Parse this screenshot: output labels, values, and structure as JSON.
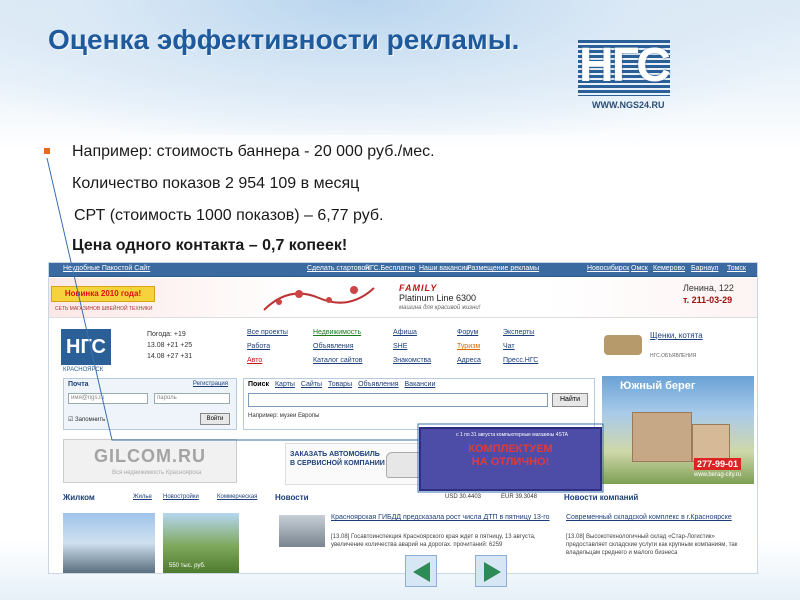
{
  "slide": {
    "title": "Оценка эффективности рекламы.",
    "logo": {
      "letters": "НГС",
      "url": "WWW.NGS24.RU"
    },
    "bullets": [
      "Например: стоимость баннера - 20 000 руб./мес.",
      "Количество показов 2 954 109 в месяц",
      "СРТ (стоимость 1000 показов) – 6,77 руб.",
      "Цена одного контакта – 0,7 копеек!"
    ],
    "accent_color": "#1f5a9c",
    "bullet_color": "#e86a1a"
  },
  "site": {
    "topbar": {
      "left_links": [
        "Неудобные Пакостой Сайт",
        "Сделать стартовой",
        "НГС.Бесплатно",
        "Наши вакансии",
        "Размещение рекламы"
      ],
      "right_links": [
        "Новосибирск",
        "Омск",
        "Кемерово",
        "Барнаул",
        "Томск"
      ]
    },
    "banner": {
      "badge": "Новинка 2010 года!",
      "badge_sub": "СЕТЬ МАГАЗИНОВ ШВЕЙНОЙ ТЕХНИКИ",
      "brand": "FAMILY",
      "model": "Platinum Line 6300",
      "slogan": "машина для красивой жизни!",
      "address": "Ленина, 122",
      "phone": "т. 211-03-29"
    },
    "logo": {
      "letters": "НГС",
      "city": "КРАСНОЯРСК"
    },
    "weather": [
      "Погода: +19",
      "13.08 +21 +25",
      "14.08 +27 +31"
    ],
    "nav": {
      "col1": [
        "Все проекты",
        "Работа",
        "Авто"
      ],
      "col2": [
        "Недвижимость",
        "Объявления",
        "Каталог сайтов"
      ],
      "col3": [
        "Афиша",
        "SHE",
        "Знакомства"
      ],
      "col4": [
        "Форум",
        "Туризм",
        "Адреса"
      ],
      "col5": [
        "Эксперты",
        "Чат",
        "Пресс.НГС"
      ]
    },
    "promo": {
      "title": "Щенки, котята",
      "sub": "НГС.ОБЪЯВЛЕНИЯ"
    },
    "mail": {
      "heading": "Почта",
      "register": "Регистрация",
      "login_placeholder": "имя@ngs.ru",
      "password_placeholder": "пароль",
      "remember": "Запомнить",
      "submit": "Войти"
    },
    "search": {
      "label": "Поиск",
      "tabs": [
        "Карты",
        "Сайты",
        "Товары",
        "Объявления",
        "Вакансии"
      ],
      "button": "Найти",
      "example": "Например: музеи Европы"
    },
    "ad_right": {
      "title": "Южный берег",
      "phone": "277-99-01",
      "url": "www.berag-city.ru"
    },
    "gilcom": {
      "logo": "GILCOM.RU",
      "sub": "Вся недвижимость Красноярска"
    },
    "car_ad": {
      "line1": "ЗАКАЗАТЬ АВТОМОБИЛЬ",
      "line2": "В СЕРВИСНОЙ КОМПАНИИ"
    },
    "overlay_ad": {
      "small": "с 1 по 31 августа компьютерные магазины 4STA",
      "big_line1": "КОМПЛЕКТУЕМ",
      "big_line2": "НА ОТЛИЧНО!"
    },
    "sections": {
      "realty": {
        "title": "Жилком",
        "tabs": [
          "Жилье",
          "Новостройки",
          "Коммерческая"
        ],
        "photo_caption": "550 тыс. руб."
      },
      "news": {
        "title": "Новости",
        "usd": "USD 30.4403",
        "eur": "EUR 39.3048",
        "item_title": "Красноярская ГИБДД предсказала рост числа ДТП в пятницу 13-го",
        "item_text": "[13.08] Госавтоинспекция Красноярского края ждет в пятницу, 13 августа, увеличение количества аварий на дорогах. прочитаний: 6259"
      },
      "company": {
        "title": "Новости компаний",
        "item_title": "Современный складской комплекс в г.Красноярске",
        "item_text": "[13.08] Высокотехнологичный склад «Стар-Логистик» предоставляет складские услуги как крупным компаниям, так владельцам среднего и малого бизнеса"
      }
    }
  }
}
